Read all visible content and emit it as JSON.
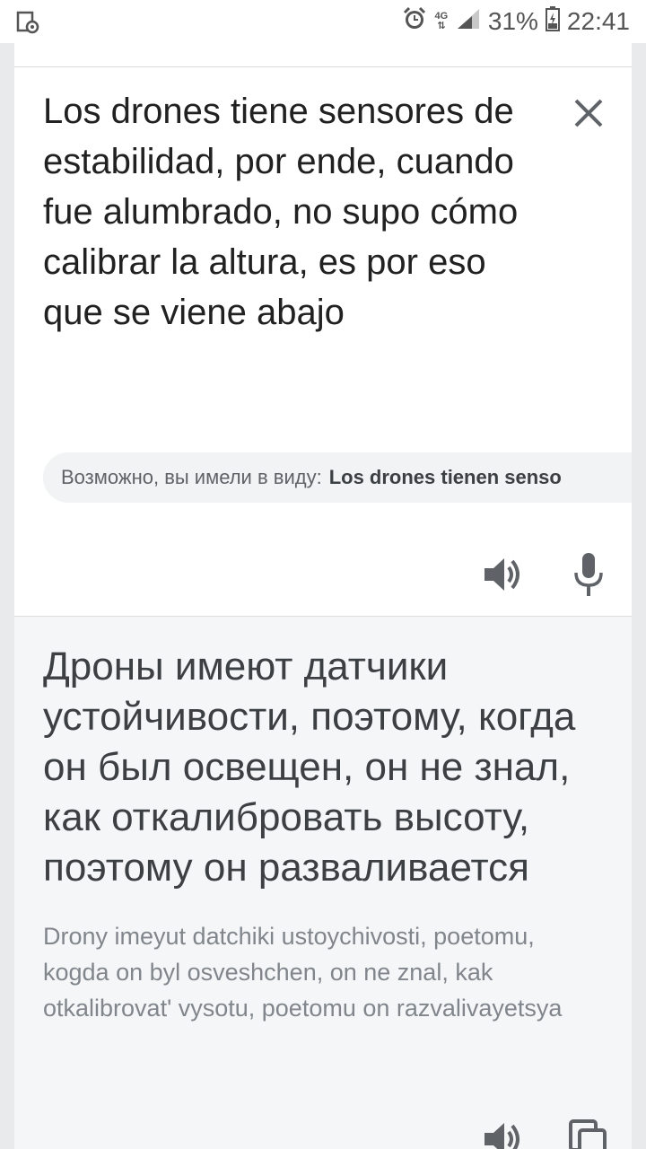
{
  "status_bar": {
    "network": "4G",
    "battery": "31%",
    "time": "22:41"
  },
  "source": {
    "text": "Los drones tiene sensores de estabilidad, por ende, cuando fue alumbrado, no supo cómo calibrar la altura, es por eso que se viene abajo",
    "suggestion_prefix": "Возможно, вы имели в виду:",
    "suggestion_text": "Los drones tienen senso"
  },
  "translation": {
    "text": "Дроны имеют датчики устойчивости, поэтому, когда он был освещен, он не знал, как откалибровать высоту, поэтому он разваливается",
    "transliteration": "Drony imeyut datchiki ustoychivosti, poetomu, kogda on byl osveshchen, on ne znal, kak otkalibrovat' vysotu, poetomu on razvalivayetsya"
  },
  "icons": {
    "screenshot": "screenshot-notification-icon",
    "alarm": "alarm-clock-icon",
    "signal": "signal-strength-icon",
    "battery": "battery-charging-icon",
    "clear": "close-icon",
    "speak": "speaker-icon",
    "mic": "microphone-icon",
    "copy": "copy-icon"
  },
  "colors": {
    "text_primary": "#212121",
    "translation_bg": "#f5f6f8",
    "suggestion_bg": "#f1f3f4",
    "icon": "#5f6368"
  }
}
